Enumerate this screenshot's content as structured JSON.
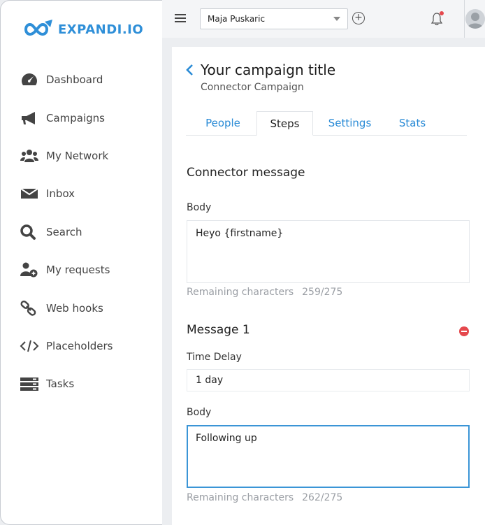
{
  "brand": {
    "name": "EXPANDI.IO",
    "color": "#2f8fd8"
  },
  "sidebar": {
    "items": [
      {
        "label": "Dashboard",
        "icon": "dashboard-icon"
      },
      {
        "label": "Campaigns",
        "icon": "megaphone-icon"
      },
      {
        "label": "My Network",
        "icon": "users-icon"
      },
      {
        "label": "Inbox",
        "icon": "envelope-icon"
      },
      {
        "label": "Search",
        "icon": "search-icon"
      },
      {
        "label": "My requests",
        "icon": "user-plus-icon"
      },
      {
        "label": "Web hooks",
        "icon": "link-icon"
      },
      {
        "label": "Placeholders",
        "icon": "code-icon"
      },
      {
        "label": "Tasks",
        "icon": "server-icon"
      }
    ]
  },
  "topbar": {
    "account_select": "Maja Puskaric",
    "add_icon": "plus-circle-icon",
    "notification_icon": "bell-icon",
    "avatar_icon": "avatar-icon"
  },
  "campaign": {
    "title": "Your campaign title",
    "type": "Connector Campaign"
  },
  "tabs": [
    {
      "label": "People",
      "active": false
    },
    {
      "label": "Steps",
      "active": true
    },
    {
      "label": "Settings",
      "active": false
    },
    {
      "label": "Stats",
      "active": false
    }
  ],
  "connector": {
    "heading": "Connector message",
    "body_label": "Body",
    "body_value": "Heyo {firstname}",
    "remaining_label": "Remaining characters",
    "remaining_count": "259/275"
  },
  "message1": {
    "heading": "Message 1",
    "delay_label": "Time Delay",
    "delay_value": "1 day",
    "body_label": "Body",
    "body_value": "Following up",
    "remaining_label": "Remaining characters",
    "remaining_count": "262/275"
  },
  "colors": {
    "accent": "#2a8bd6",
    "danger": "#e5484d",
    "focus": "#3b95d6"
  }
}
